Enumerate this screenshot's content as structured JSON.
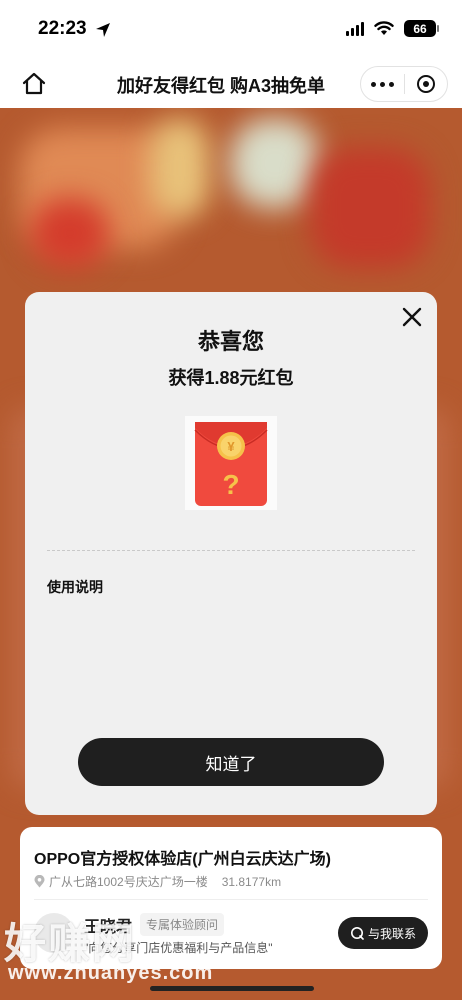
{
  "status_bar": {
    "time": "22:23",
    "battery": "66"
  },
  "nav": {
    "title": "加好友得红包 购A3抽免单"
  },
  "modal": {
    "title": "恭喜您",
    "subtitle": "获得1.88元红包",
    "envelope": {
      "currency_symbol": "¥",
      "mark": "?"
    },
    "usage_title": "使用说明",
    "ok_label": "知道了"
  },
  "store": {
    "name": "OPPO官方授权体验店(广州白云庆达广场)",
    "address": "广从七路1002号庆达广场一楼",
    "distance": "31.8177km",
    "consultant_name": "王晓君",
    "consultant_badge": "专属体验顾问",
    "consultant_desc": "\"向您分享门店优惠福利与产品信息\"",
    "contact_label": "与我联系"
  },
  "watermark": {
    "text": "好赚网",
    "url": "www.zhuanyes.com"
  },
  "colors": {
    "background": "#b55a2f",
    "button_dark": "#1f1f1f",
    "envelope_red": "#f04a3e",
    "coin_gold": "#f6c14a"
  }
}
